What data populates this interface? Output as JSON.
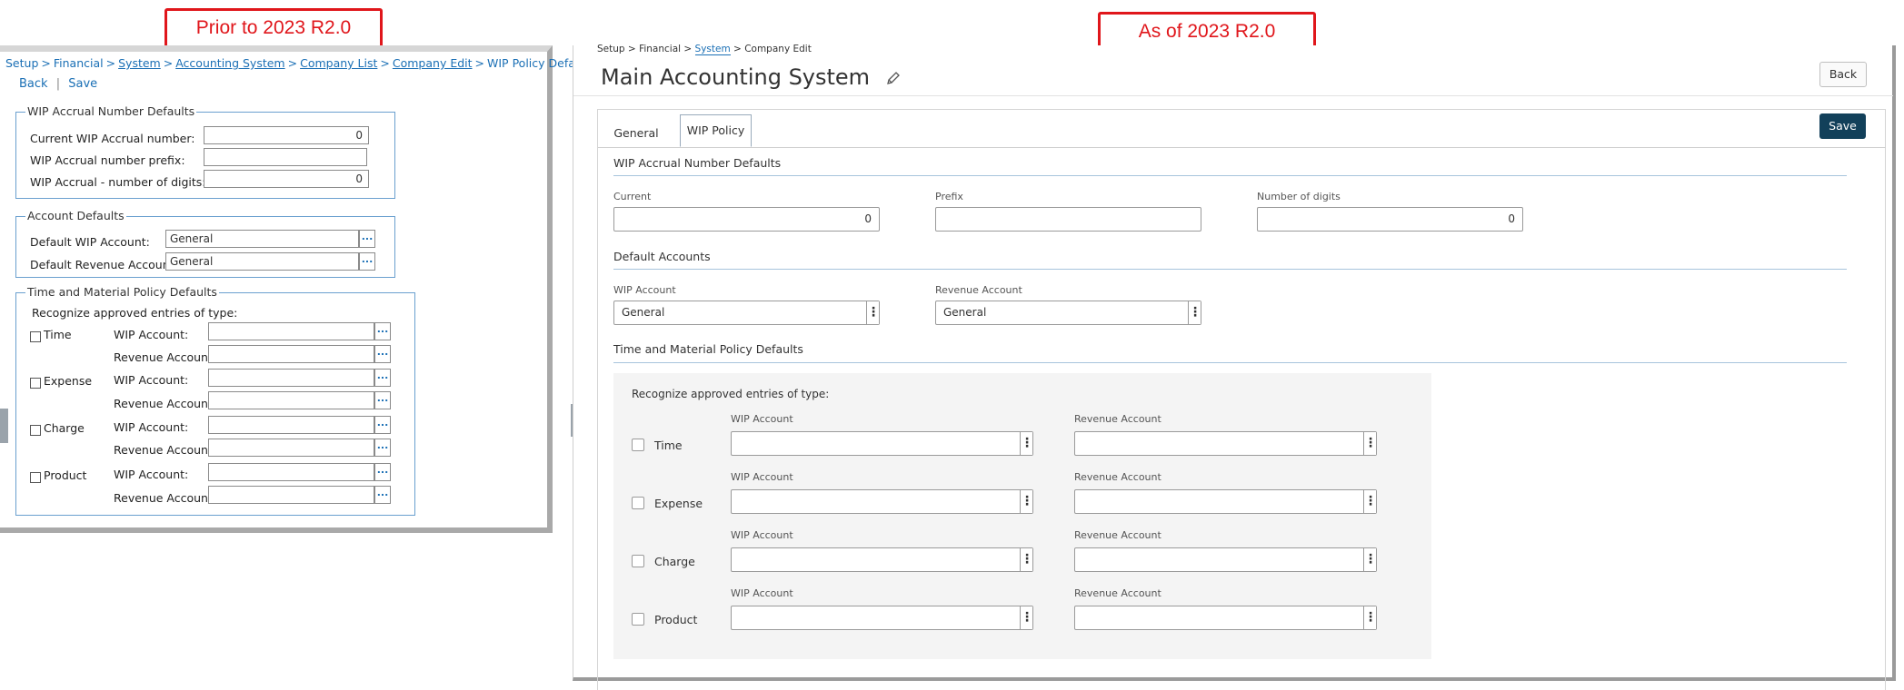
{
  "callouts": {
    "before": "Prior to 2023 R2.0",
    "after": "As of 2023 R2.0"
  },
  "old_ui": {
    "breadcrumb": [
      "Setup",
      "Financial",
      "System",
      "Accounting System",
      "Company List",
      "Company Edit",
      "WIP Policy Defaults"
    ],
    "actions": {
      "back": "Back",
      "separator": "|",
      "save": "Save"
    },
    "wip_accrual": {
      "legend": "WIP Accrual Number Defaults",
      "current_label": "Current WIP Accrual number:",
      "current_value": "0",
      "prefix_label": "WIP Accrual number prefix:",
      "prefix_value": "",
      "digits_label": "WIP Accrual - number of digits:",
      "digits_value": "0"
    },
    "account_defaults": {
      "legend": "Account Defaults",
      "wip_label": "Default WIP Account:",
      "wip_value": "General",
      "revenue_label": "Default Revenue Account:",
      "revenue_value": "General"
    },
    "tm_policy": {
      "legend": "Time and Material Policy Defaults",
      "recognize_label": "Recognize approved entries of type:",
      "wip_label": "WIP Account:",
      "revenue_label": "Revenue Account:",
      "types": [
        "Time",
        "Expense",
        "Charge",
        "Product"
      ]
    },
    "lookup_glyph": "..."
  },
  "new_ui": {
    "breadcrumb": {
      "setup": "Setup",
      "financial": "Financial",
      "system": "System",
      "company_edit": "Company Edit",
      "sep": ">"
    },
    "title": "Main Accounting System",
    "back_button": "Back",
    "save_button": "Save",
    "tabs": [
      "General",
      "WIP Policy"
    ],
    "wip_accrual": {
      "title": "WIP Accrual Number Defaults",
      "current_label": "Current",
      "current_value": "0",
      "prefix_label": "Prefix",
      "prefix_value": "",
      "digits_label": "Number of digits",
      "digits_value": "0"
    },
    "default_accounts": {
      "title": "Default Accounts",
      "wip_label": "WIP Account",
      "wip_value": "General",
      "revenue_label": "Revenue Account",
      "revenue_value": "General"
    },
    "tm_policy": {
      "title": "Time and Material Policy Defaults",
      "recognize_label": "Recognize approved entries of type:",
      "wip_label": "WIP Account",
      "revenue_label": "Revenue Account",
      "types": [
        "Time",
        "Expense",
        "Charge",
        "Product"
      ]
    },
    "kebab_glyph": "⋮",
    "colors": {
      "save_bg": "#12405a",
      "link": "#1a6fb5",
      "rule": "#a7c4dc"
    }
  }
}
